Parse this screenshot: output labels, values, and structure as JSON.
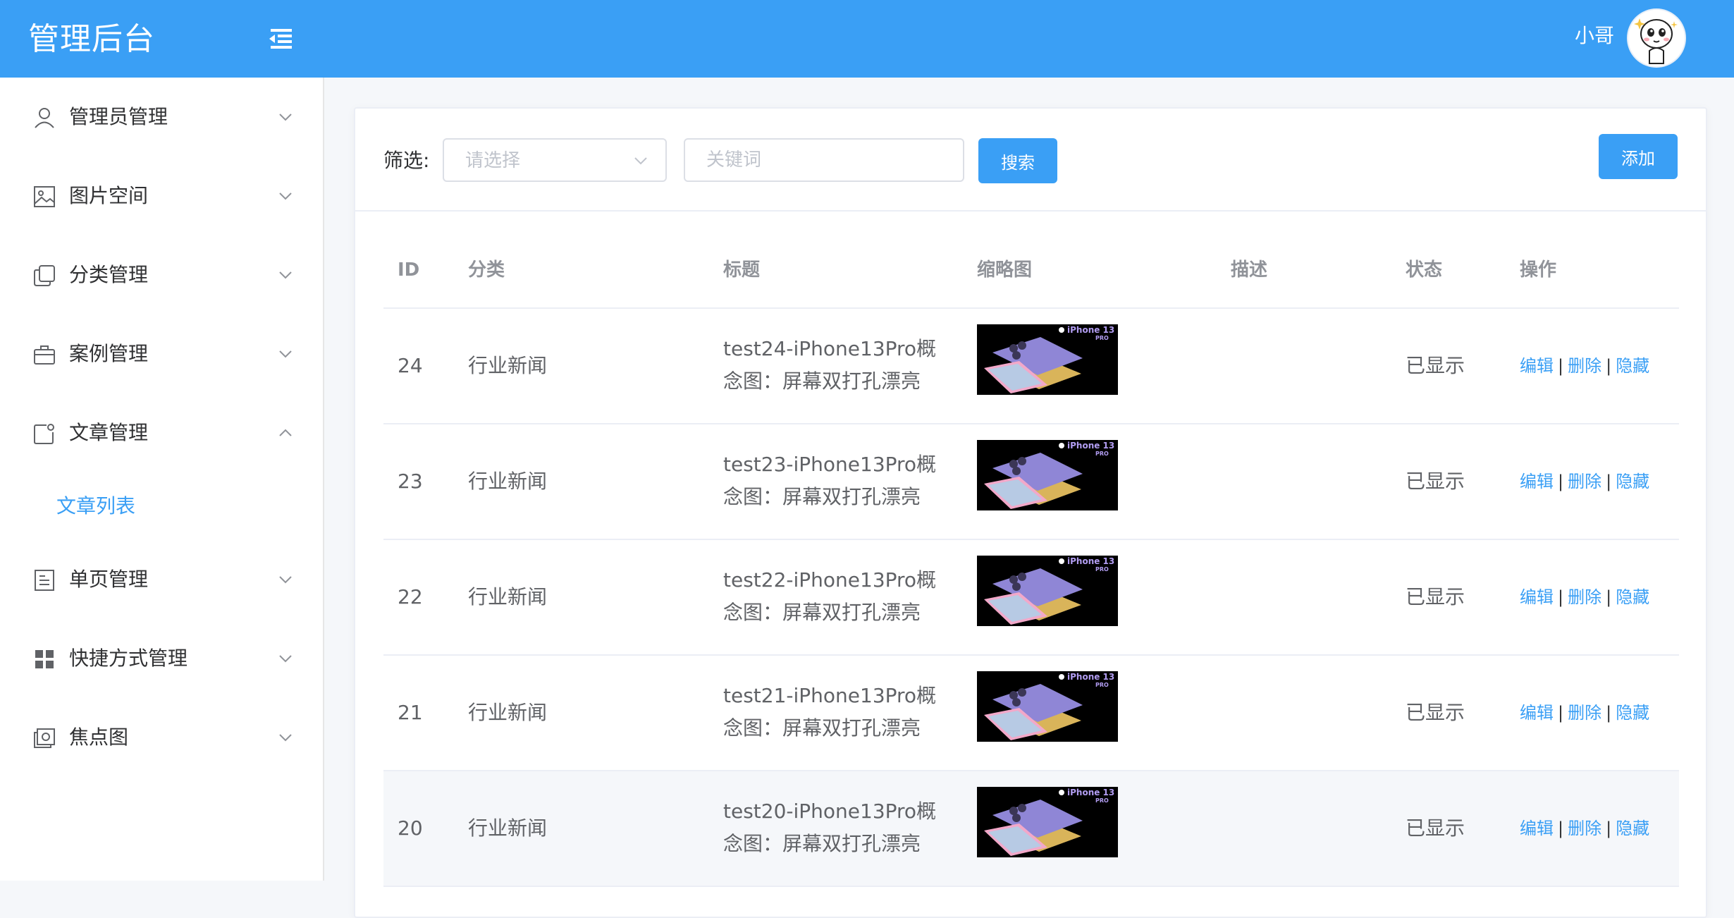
{
  "header": {
    "title": "管理后台",
    "user_name": "小哥"
  },
  "sidebar": {
    "items": [
      {
        "label": "管理员管理",
        "icon": "user-icon"
      },
      {
        "label": "图片空间",
        "icon": "image-icon"
      },
      {
        "label": "分类管理",
        "icon": "copy-icon"
      },
      {
        "label": "案例管理",
        "icon": "briefcase-icon"
      },
      {
        "label": "文章管理",
        "icon": "article-icon",
        "expanded": true
      },
      {
        "label": "单页管理",
        "icon": "document-icon"
      },
      {
        "label": "快捷方式管理",
        "icon": "grid-icon"
      },
      {
        "label": "焦点图",
        "icon": "photo-icon"
      }
    ],
    "sub_items": [
      {
        "label": "文章列表"
      }
    ]
  },
  "filter": {
    "label": "筛选:",
    "select_placeholder": "请选择",
    "keyword_placeholder": "关键词",
    "search_label": "搜索",
    "add_label": "添加"
  },
  "table": {
    "columns": [
      "ID",
      "分类",
      "标题",
      "缩略图",
      "描述",
      "状态",
      "操作"
    ],
    "ops": {
      "edit": "编辑",
      "delete": "删除",
      "hide": "隐藏",
      "sep": "|"
    },
    "rows": [
      {
        "id": "24",
        "category": "行业新闻",
        "title": "test24-iPhone13Pro概念图：屏幕双打孔漂亮",
        "description": "",
        "status": "已显示"
      },
      {
        "id": "23",
        "category": "行业新闻",
        "title": "test23-iPhone13Pro概念图：屏幕双打孔漂亮",
        "description": "",
        "status": "已显示"
      },
      {
        "id": "22",
        "category": "行业新闻",
        "title": "test22-iPhone13Pro概念图：屏幕双打孔漂亮",
        "description": "",
        "status": "已显示"
      },
      {
        "id": "21",
        "category": "行业新闻",
        "title": "test21-iPhone13Pro概念图：屏幕双打孔漂亮",
        "description": "",
        "status": "已显示"
      },
      {
        "id": "20",
        "category": "行业新闻",
        "title": "test20-iPhone13Pro概念图：屏幕双打孔漂亮",
        "description": "",
        "status": "已显示"
      }
    ],
    "thumbnail_text": "iPhone 13",
    "thumbnail_sub": "PRO"
  },
  "colors": {
    "primary": "#3a9ff5",
    "text": "#606266",
    "header_text": "#909399"
  }
}
